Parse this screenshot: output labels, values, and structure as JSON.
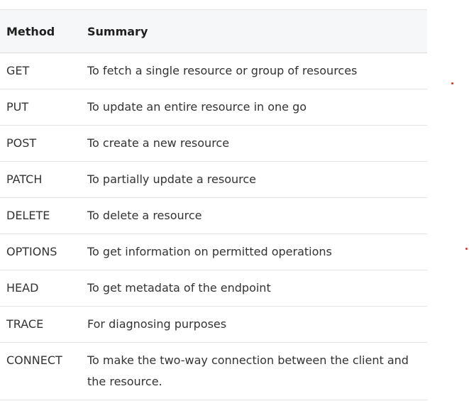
{
  "table": {
    "headers": {
      "method": "Method",
      "summary": "Summary"
    },
    "rows": [
      {
        "method": "GET",
        "summary": "To fetch a single resource or group of resources"
      },
      {
        "method": "PUT",
        "summary": "To update an entire resource in one go"
      },
      {
        "method": "POST",
        "summary": "To create a new resource"
      },
      {
        "method": "PATCH",
        "summary": "To partially update a resource"
      },
      {
        "method": "DELETE",
        "summary": "To delete a resource"
      },
      {
        "method": "OPTIONS",
        "summary": "To get information on permitted operations"
      },
      {
        "method": "HEAD",
        "summary": "To get metadata of the endpoint"
      },
      {
        "method": "TRACE",
        "summary": "For diagnosing purposes"
      },
      {
        "method": "CONNECT",
        "summary": "To make the two-way connection between the client and the resource."
      }
    ]
  },
  "colors": {
    "header_background": "#f6f7f9",
    "row_divider": "#e4e4e4",
    "marker_dot": "#d9322b"
  }
}
